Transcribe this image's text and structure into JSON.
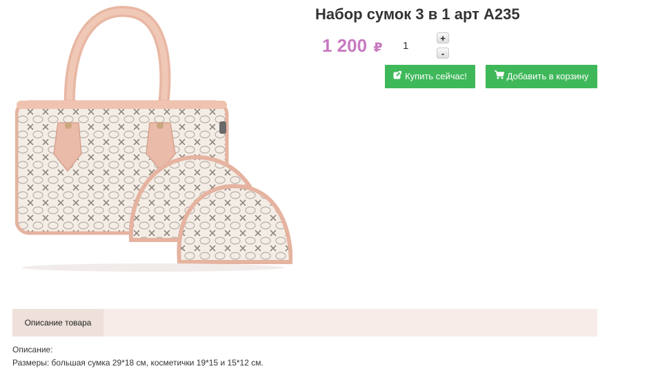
{
  "product": {
    "title": "Набор сумок 3 в 1 арт А235",
    "price": "1 200",
    "currency_symbol": "₽",
    "image_icon": "handbag-set-photo"
  },
  "quantity": {
    "value": "1",
    "increase_label": "+",
    "decrease_label": "-"
  },
  "actions": {
    "buy_now_label": "Купить сейчас!",
    "buy_now_icon": "external-link-icon",
    "add_to_cart_label": "Добавить в корзину",
    "add_to_cart_icon": "cart-icon",
    "button_color": "#3fb85a"
  },
  "tabs": [
    {
      "label": "Описание товара",
      "active": true
    }
  ],
  "description": {
    "heading": "Описание:",
    "sizes": "Размеры: большая сумка 29*18 см, косметички 19*15 и 15*12 см."
  },
  "colors": {
    "price": "#c879c0",
    "tab_bar": "#f8ece8",
    "tab_active": "#eee0da"
  }
}
